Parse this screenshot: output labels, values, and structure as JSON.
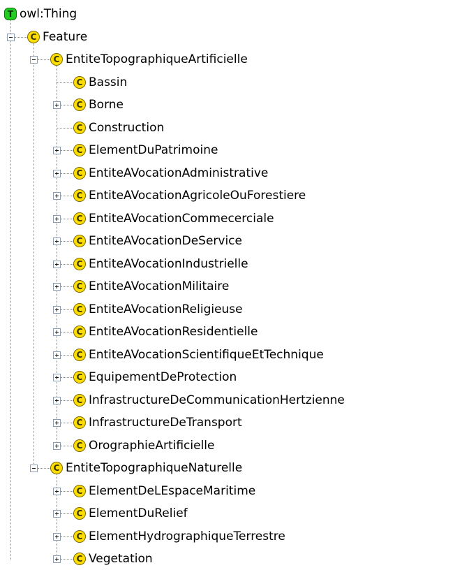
{
  "tree": {
    "root": {
      "label": "owl:Thing",
      "badge": "T",
      "children": [
        {
          "label": "Feature",
          "badge": "C",
          "expanded": true,
          "children": [
            {
              "label": "EntiteTopographiqueArtificielle",
              "badge": "C",
              "expanded": true,
              "children": [
                {
                  "label": "Bassin",
                  "badge": "C",
                  "has_children": false
                },
                {
                  "label": "Borne",
                  "badge": "C",
                  "has_children": true
                },
                {
                  "label": "Construction",
                  "badge": "C",
                  "has_children": false
                },
                {
                  "label": "ElementDuPatrimoine",
                  "badge": "C",
                  "has_children": true
                },
                {
                  "label": "EntiteAVocationAdministrative",
                  "badge": "C",
                  "has_children": true
                },
                {
                  "label": "EntiteAVocationAgricoleOuForestiere",
                  "badge": "C",
                  "has_children": true
                },
                {
                  "label": "EntiteAVocationCommecerciale",
                  "badge": "C",
                  "has_children": true
                },
                {
                  "label": "EntiteAVocationDeService",
                  "badge": "C",
                  "has_children": true
                },
                {
                  "label": "EntiteAVocationIndustrielle",
                  "badge": "C",
                  "has_children": true
                },
                {
                  "label": "EntiteAVocationMilitaire",
                  "badge": "C",
                  "has_children": true
                },
                {
                  "label": "EntiteAVocationReligieuse",
                  "badge": "C",
                  "has_children": true
                },
                {
                  "label": "EntiteAVocationResidentielle",
                  "badge": "C",
                  "has_children": true
                },
                {
                  "label": "EntiteAVocationScientifiqueEtTechnique",
                  "badge": "C",
                  "has_children": true
                },
                {
                  "label": "EquipementDeProtection",
                  "badge": "C",
                  "has_children": true
                },
                {
                  "label": "InfrastructureDeCommunicationHertzienne",
                  "badge": "C",
                  "has_children": true
                },
                {
                  "label": "InfrastructureDeTransport",
                  "badge": "C",
                  "has_children": true
                },
                {
                  "label": "OrographieArtificielle",
                  "badge": "C",
                  "has_children": true
                }
              ]
            },
            {
              "label": "EntiteTopographiqueNaturelle",
              "badge": "C",
              "expanded": true,
              "children": [
                {
                  "label": "ElementDeLEspaceMaritime",
                  "badge": "C",
                  "has_children": true
                },
                {
                  "label": "ElementDuRelief",
                  "badge": "C",
                  "has_children": true
                },
                {
                  "label": "ElementHydrographiqueTerrestre",
                  "badge": "C",
                  "has_children": true
                },
                {
                  "label": "Vegetation",
                  "badge": "C",
                  "has_children": true
                }
              ]
            }
          ]
        }
      ]
    }
  },
  "colors": {
    "class_badge": "#ffdd00",
    "thing_badge": "#22cc22",
    "guide_line": "#8a8a8a",
    "expander_border": "#8b9bb0"
  },
  "icons": {
    "class": "owl-class-icon",
    "thing": "owl-thing-icon",
    "expand": "expand-plus-icon",
    "collapse": "collapse-minus-icon"
  }
}
